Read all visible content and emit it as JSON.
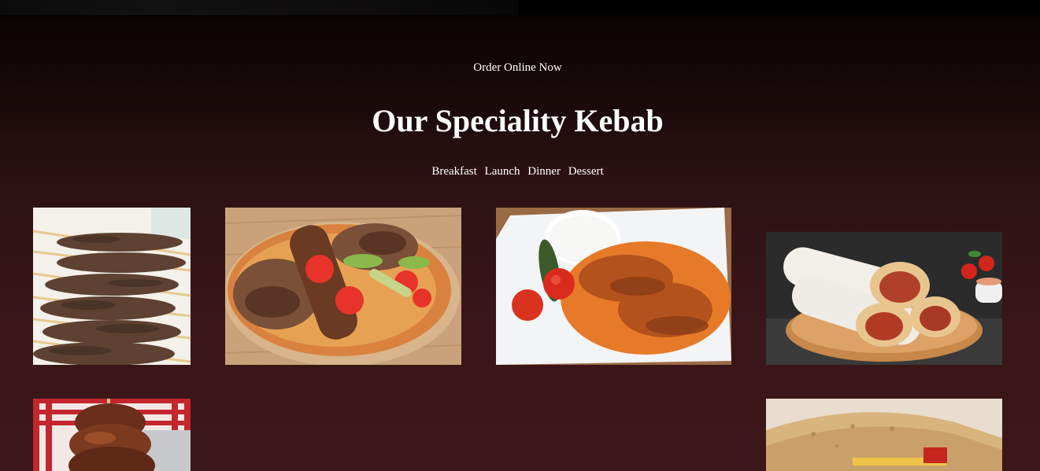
{
  "order_link": "Order Online Now",
  "section_title": "Our Speciality Kebab",
  "filters": [
    "Breakfast",
    "Launch",
    "Dinner",
    "Dessert"
  ],
  "menu_images": [
    {
      "icon": "adana-kebab-skewers-image"
    },
    {
      "icon": "doner-kebab-platter-image"
    },
    {
      "icon": "iskender-kebab-plate-image"
    },
    {
      "icon": "kebab-wrap-rolls-image"
    },
    {
      "icon": "grilled-chicken-skewer-image"
    },
    {
      "icon": "pita-sandwich-image"
    }
  ],
  "colors": {
    "background_top": "#030101",
    "background_bottom": "#3c1719",
    "text": "#ffffff"
  }
}
